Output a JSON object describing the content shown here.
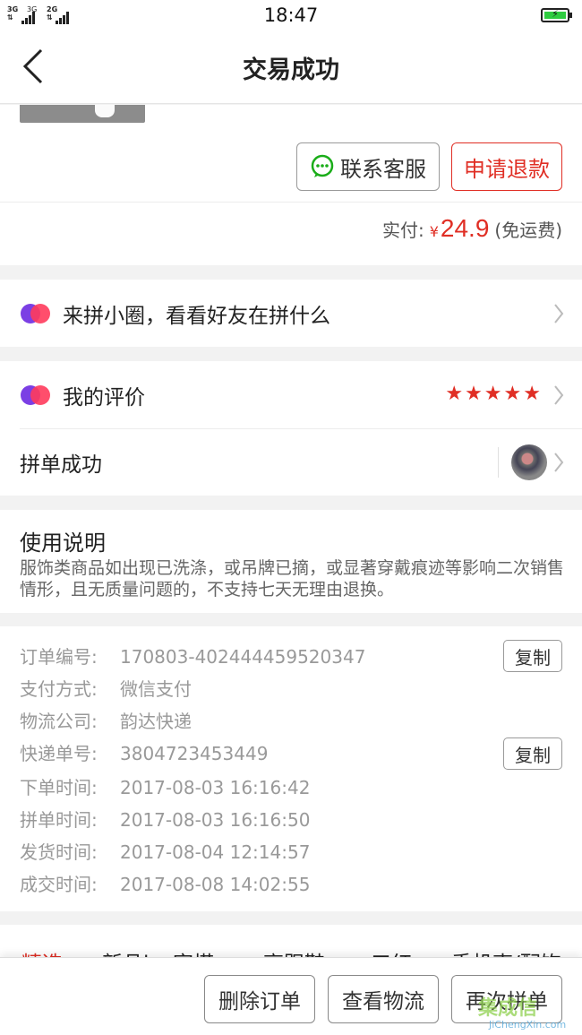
{
  "status_bar": {
    "net1": "3G",
    "net2": "3G",
    "net3": "2G",
    "time": "18:47"
  },
  "header": {
    "title": "交易成功"
  },
  "order_actions": {
    "contact": "联系客服",
    "refund": "申请退款"
  },
  "payment": {
    "label": "实付:",
    "currency": "¥",
    "amount": "24.9",
    "shipping": "(免运费)"
  },
  "circle": {
    "label": "来拼小圈，看看好友在拼什么"
  },
  "review": {
    "label": "我的评价",
    "rating": 5,
    "stars": "★★★★★"
  },
  "group": {
    "label": "拼单成功"
  },
  "usage": {
    "title": "使用说明",
    "body": "服饰类商品如出现已洗涤，或吊牌已摘，或显著穿戴痕迹等影响二次销售情形，且无质量问题的，不支持七天无理由退换。"
  },
  "order_info": {
    "copy_label": "复制",
    "rows": [
      {
        "key": "订单编号:",
        "value": "170803-402444459520347"
      },
      {
        "key": "支付方式:",
        "value": "微信支付"
      },
      {
        "key": "物流公司:",
        "value": "韵达快递"
      },
      {
        "key": "快递单号:",
        "value": "3804723453449"
      },
      {
        "key": "下单时间:",
        "value": "2017-08-03 16:16:42"
      },
      {
        "key": "拼单时间:",
        "value": "2017-08-03 16:16:50"
      },
      {
        "key": "发货时间:",
        "value": "2017-08-04 12:14:57"
      },
      {
        "key": "成交时间:",
        "value": "2017-08-08 14:02:55"
      }
    ]
  },
  "rec_tabs": [
    "精选",
    "新品ins穿搭",
    "高跟鞋",
    "口红",
    "手机壳/配饰"
  ],
  "bottom_bar": {
    "delete": "删除订单",
    "logistics": "查看物流",
    "reorder": "再次拼单"
  },
  "watermark": {
    "top": "集成信",
    "bottom": "JiChengXin.com"
  },
  "colors": {
    "accent": "#e02e24",
    "wechat_green": "#1aad19",
    "logo_purple": "#7b3fe4",
    "logo_red": "#ff3b5c"
  }
}
